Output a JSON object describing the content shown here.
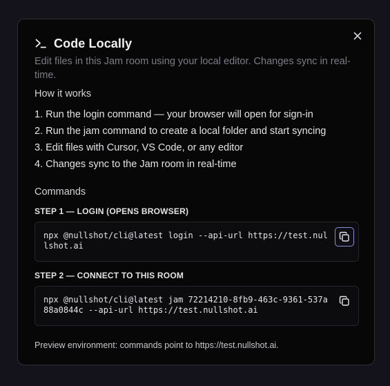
{
  "dialog": {
    "title": "Code Locally",
    "description": "Edit files in this Jam room using your local editor. Changes sync in real-time.",
    "close_icon": "close-icon",
    "title_icon": "terminal-icon"
  },
  "how_it_works": {
    "heading": "How it works",
    "steps": [
      "1. Run the login command — your browser will open for sign-in",
      "2. Run the jam command to create a local folder and start syncing",
      "3. Edit files with Cursor, VS Code, or any editor",
      "4. Changes sync to the Jam room in real-time"
    ]
  },
  "commands": {
    "heading": "Commands",
    "step1": {
      "label": "STEP 1 — LOGIN (OPENS BROWSER)",
      "command": "npx @nullshot/cli@latest login --api-url https://test.nullshot.ai"
    },
    "step2": {
      "label": "STEP 2 — CONNECT TO THIS ROOM",
      "command": "npx @nullshot/cli@latest jam 72214210-8fb9-463c-9361-537a88a0844c --api-url https://test.nullshot.ai"
    }
  },
  "footer": {
    "note": "Preview environment: commands point to https://test.nullshot.ai."
  },
  "colors": {
    "accent_focus": "#8b8fd8",
    "modal_bg": "#070707",
    "muted_text": "#7c7c86"
  }
}
